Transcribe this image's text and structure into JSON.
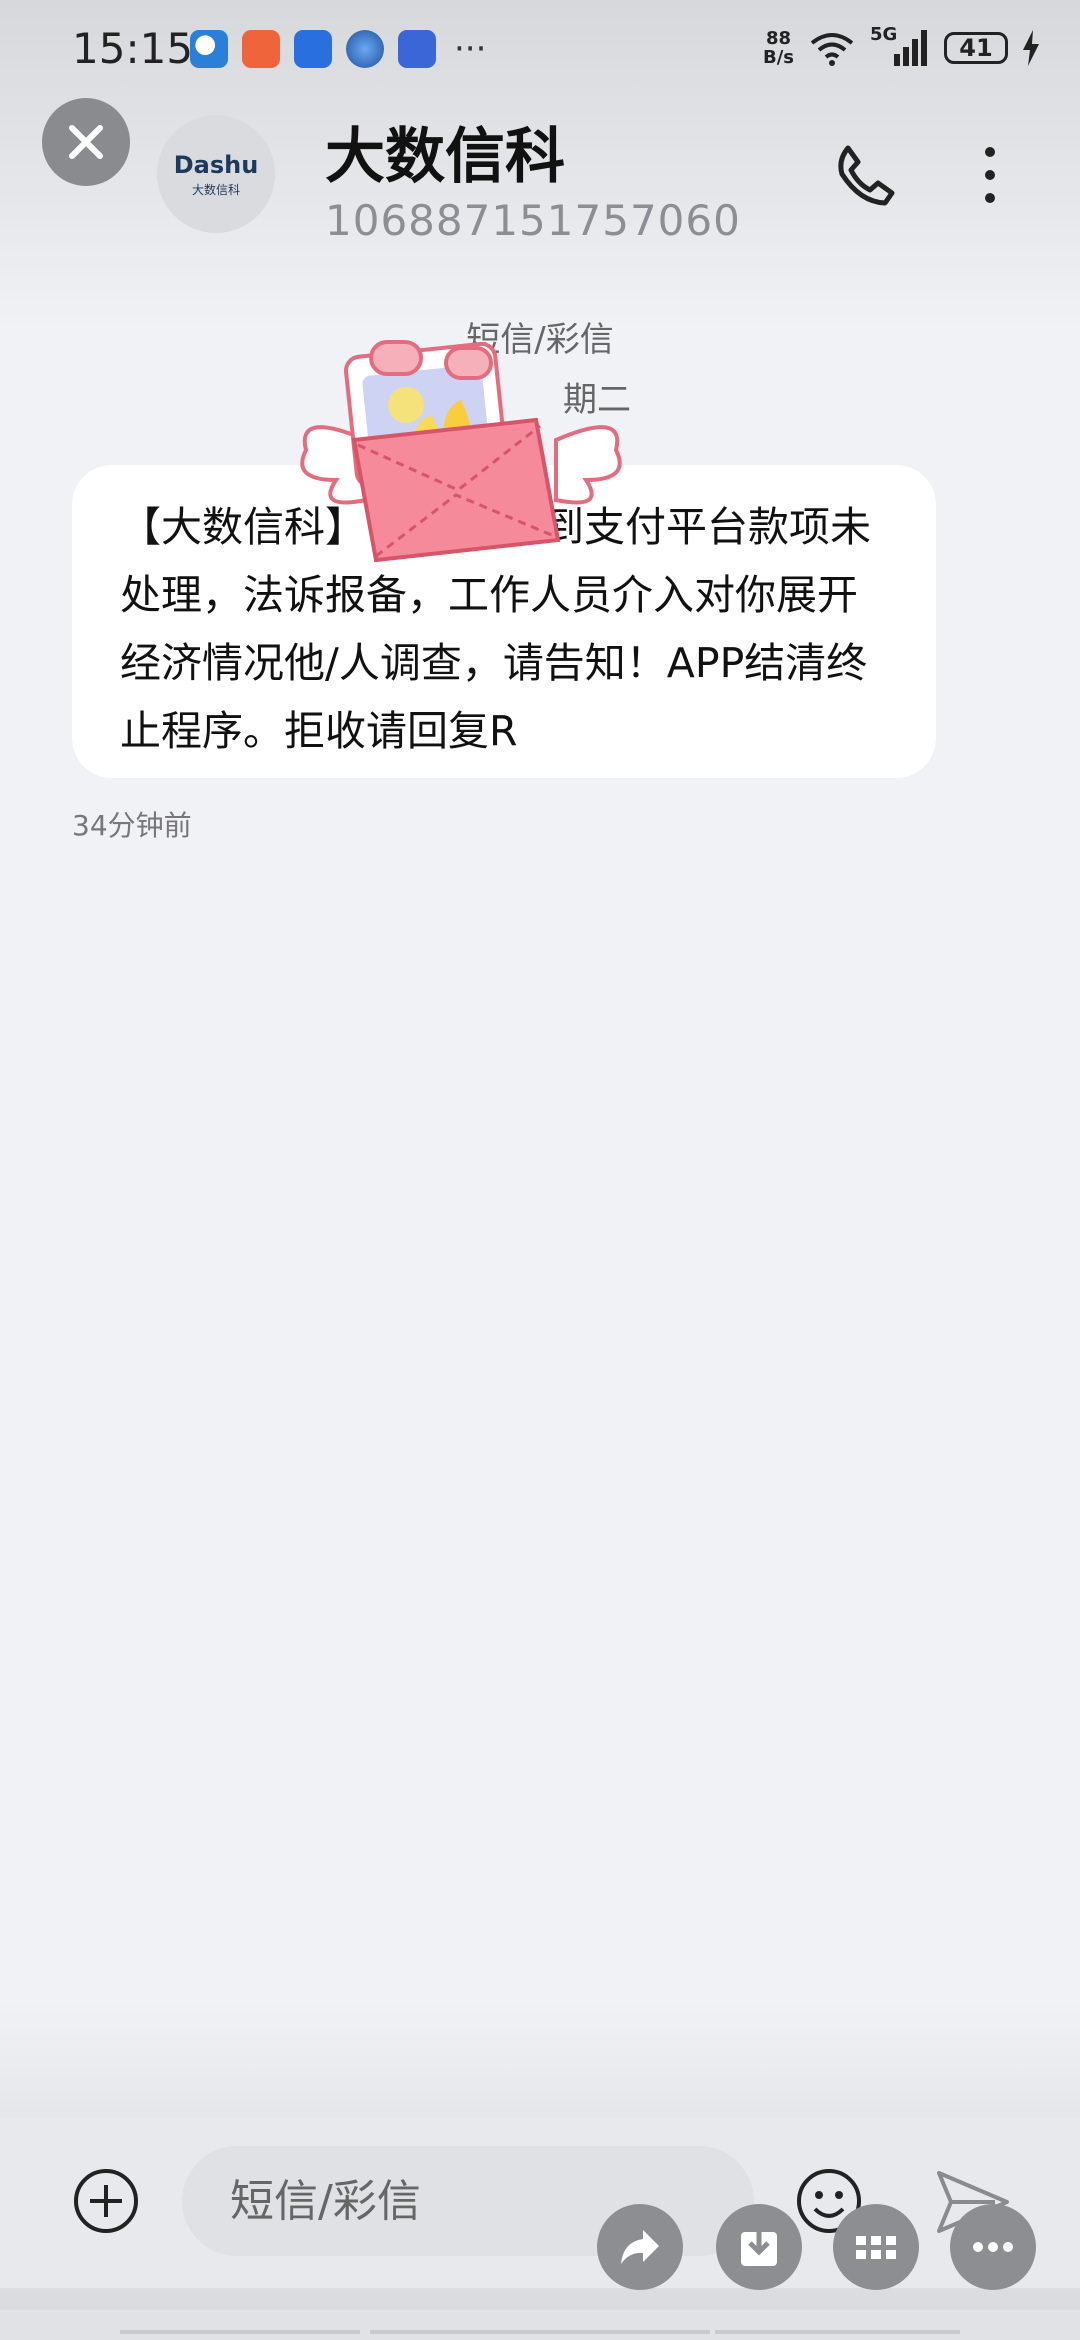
{
  "status_bar": {
    "time": "15:15",
    "more": "···",
    "net_speed_value": "88",
    "net_speed_unit": "B/s",
    "signal_type": "5G",
    "battery": "41"
  },
  "header": {
    "contact_name": "大数信科",
    "contact_number": "106887151757060",
    "avatar_logo_top": "Dashu",
    "avatar_logo_bottom": "大数信科"
  },
  "conversation": {
    "message_type": "短信/彩信",
    "date": "期二",
    "message_text": "【大数信科】 ，我部收到支付平台款项未处理，法诉报备，工作人员介入对你展开经济情况他/人调查，请告知！APP结清终止程序。拒收请回复R",
    "timestamp": "34分钟前"
  },
  "composer": {
    "placeholder": "短信/彩信"
  },
  "colors": {
    "background": "#f1f2f6",
    "bubble": "#ffffff",
    "envelope": "#f48a9a",
    "accent": "#1d3a5c"
  },
  "icons": [
    "close-icon",
    "phone-icon",
    "more-vertical-icon",
    "add-icon",
    "emoji-icon",
    "send-icon",
    "share-icon",
    "download-icon",
    "grid-icon",
    "more-horizontal-icon"
  ]
}
